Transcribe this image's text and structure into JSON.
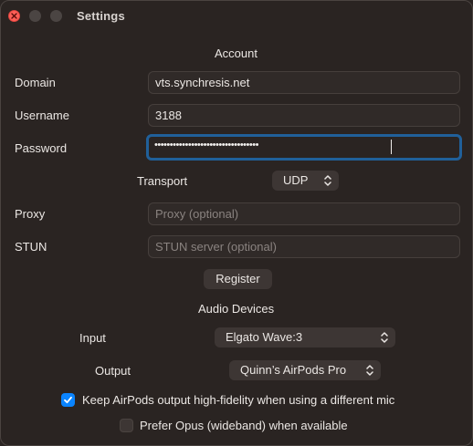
{
  "window": {
    "title": "Settings"
  },
  "account": {
    "heading": "Account",
    "domain_label": "Domain",
    "domain_value": "vts.synchresis.net",
    "username_label": "Username",
    "username_value": "3188",
    "password_label": "Password",
    "password_mask": "••••••••••••••••••••••••••••••••••",
    "transport_label": "Transport",
    "transport_value": "UDP",
    "proxy_label": "Proxy",
    "proxy_placeholder": "Proxy (optional)",
    "stun_label": "STUN",
    "stun_placeholder": "STUN server (optional)",
    "register_label": "Register"
  },
  "audio": {
    "heading": "Audio Devices",
    "input_label": "Input",
    "input_value": "Elgato Wave:3",
    "output_label": "Output",
    "output_value": "Quinn’s AirPods Pro",
    "keep_hifi_label": "Keep AirPods output high-fidelity when using a different mic",
    "keep_hifi_checked": true,
    "prefer_opus_label": "Prefer Opus (wideband) when available",
    "prefer_opus_checked": false
  },
  "colors": {
    "window_bg": "#2a2422",
    "focus_ring": "#20609a",
    "checkbox_accent": "#0a84ff",
    "close_button": "#ff5f57"
  },
  "icons": {
    "close": "close-icon",
    "popup_arrows": "chevron-up-down-icon",
    "check": "checkmark-icon"
  }
}
